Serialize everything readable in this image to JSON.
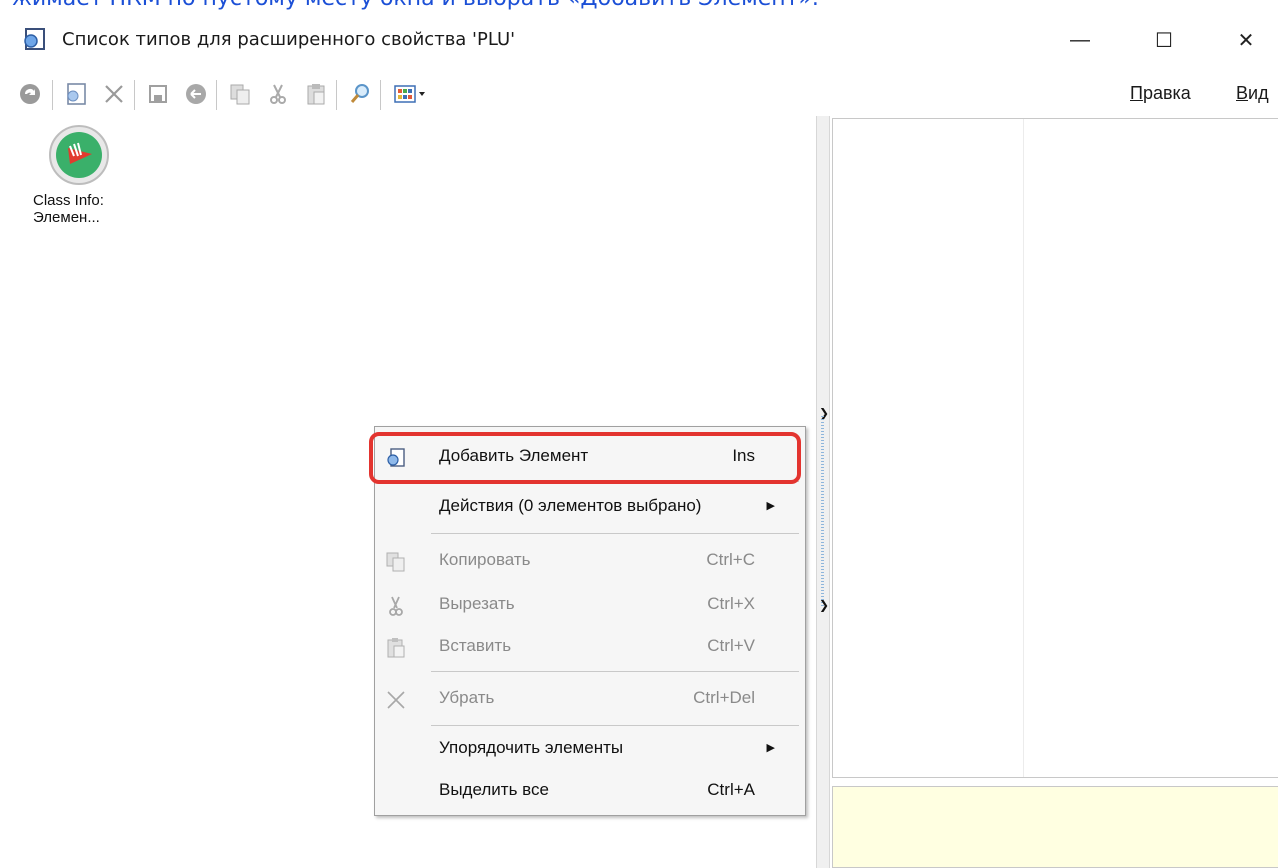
{
  "caption": {
    "text": "жимает ПКМ по пустому месту окна и выбрать «Добавить Элемент»."
  },
  "window": {
    "title": "Список типов для расширенного свойства 'PLU'",
    "controls": {
      "minimize": "—",
      "maximize": "☐",
      "close": "✕"
    }
  },
  "toolbar": {
    "buttons": [
      "refresh-icon",
      "add-element-icon",
      "delete-icon",
      "save-icon",
      "undo-icon",
      "copy-icon",
      "cut-icon",
      "paste-icon",
      "search-icon",
      "view-grid-icon"
    ],
    "menus": [
      {
        "mnemonic": "П",
        "rest": "равка"
      },
      {
        "mnemonic": "В",
        "rest": "ид"
      }
    ]
  },
  "list": {
    "items": [
      {
        "label": "Class Info: Элемен...",
        "icon": "class-info-icon"
      }
    ]
  },
  "context_menu": {
    "items": [
      {
        "label": "Добавить Элемент",
        "shortcut": "Ins",
        "icon": "add-element-icon",
        "enabled": true
      },
      {
        "label": "Действия (0 элементов выбрано)",
        "shortcut": "",
        "submenu": true,
        "enabled": true
      },
      {
        "label": "Копировать",
        "shortcut": "Ctrl+C",
        "icon": "copy-icon",
        "enabled": false
      },
      {
        "label": "Вырезать",
        "shortcut": "Ctrl+X",
        "icon": "cut-icon",
        "enabled": false
      },
      {
        "label": "Вставить",
        "shortcut": "Ctrl+V",
        "icon": "paste-icon",
        "enabled": false
      },
      {
        "label": "Убрать",
        "shortcut": "Ctrl+Del",
        "icon": "remove-icon",
        "enabled": false
      },
      {
        "label": "Упорядочить элементы",
        "shortcut": "",
        "submenu": true,
        "enabled": true
      },
      {
        "label": "Выделить все",
        "shortcut": "Ctrl+A",
        "enabled": true
      }
    ]
  },
  "colors": {
    "highlight": "#e3342f",
    "caption": "#1b4fd6",
    "info_panel": "#ffffe1"
  }
}
